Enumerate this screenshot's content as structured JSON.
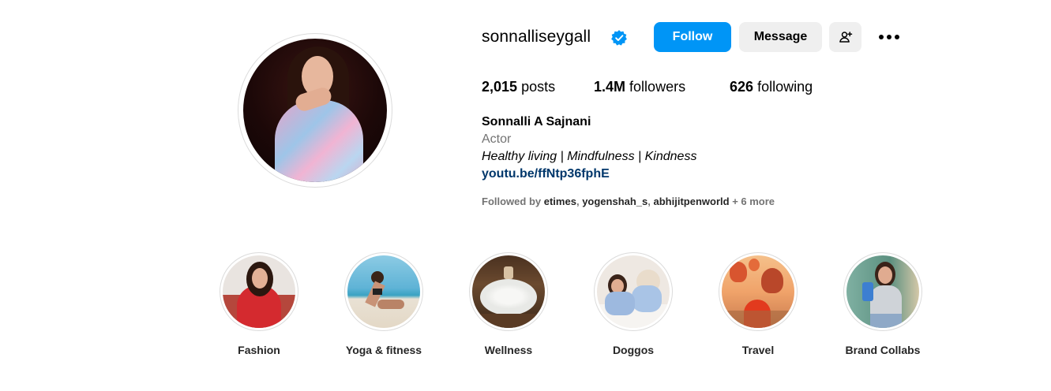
{
  "profile": {
    "username": "sonnalliseygall",
    "verified": true,
    "avatar_icon": "profile-photo",
    "buttons": {
      "follow": "Follow",
      "message": "Message",
      "suggest_icon": "add-person-icon",
      "more_icon": "more-options-icon"
    },
    "stats": {
      "posts_count": "2,015",
      "posts_label": "posts",
      "followers_count": "1.4M",
      "followers_label": "followers",
      "following_count": "626",
      "following_label": "following"
    },
    "bio": {
      "full_name": "Sonnalli A Sajnani",
      "category": "Actor",
      "text": "Healthy living | Mindfulness | Kindness",
      "link": "youtu.be/ffNtp36fphE"
    },
    "followed_by": {
      "prefix": "Followed by",
      "users": [
        "etimes",
        "yogenshah_s",
        "abhijitpenworld"
      ],
      "more": "+ 6 more"
    }
  },
  "highlights": [
    {
      "label": "Fashion"
    },
    {
      "label": "Yoga & fitness"
    },
    {
      "label": "Wellness"
    },
    {
      "label": "Doggos"
    },
    {
      "label": "Travel"
    },
    {
      "label": "Brand Collabs"
    }
  ],
  "colors": {
    "primary_button": "#0095f6",
    "secondary_button": "#efefef",
    "link": "#00376b",
    "muted": "#737373",
    "verified_badge": "#0095f6"
  }
}
